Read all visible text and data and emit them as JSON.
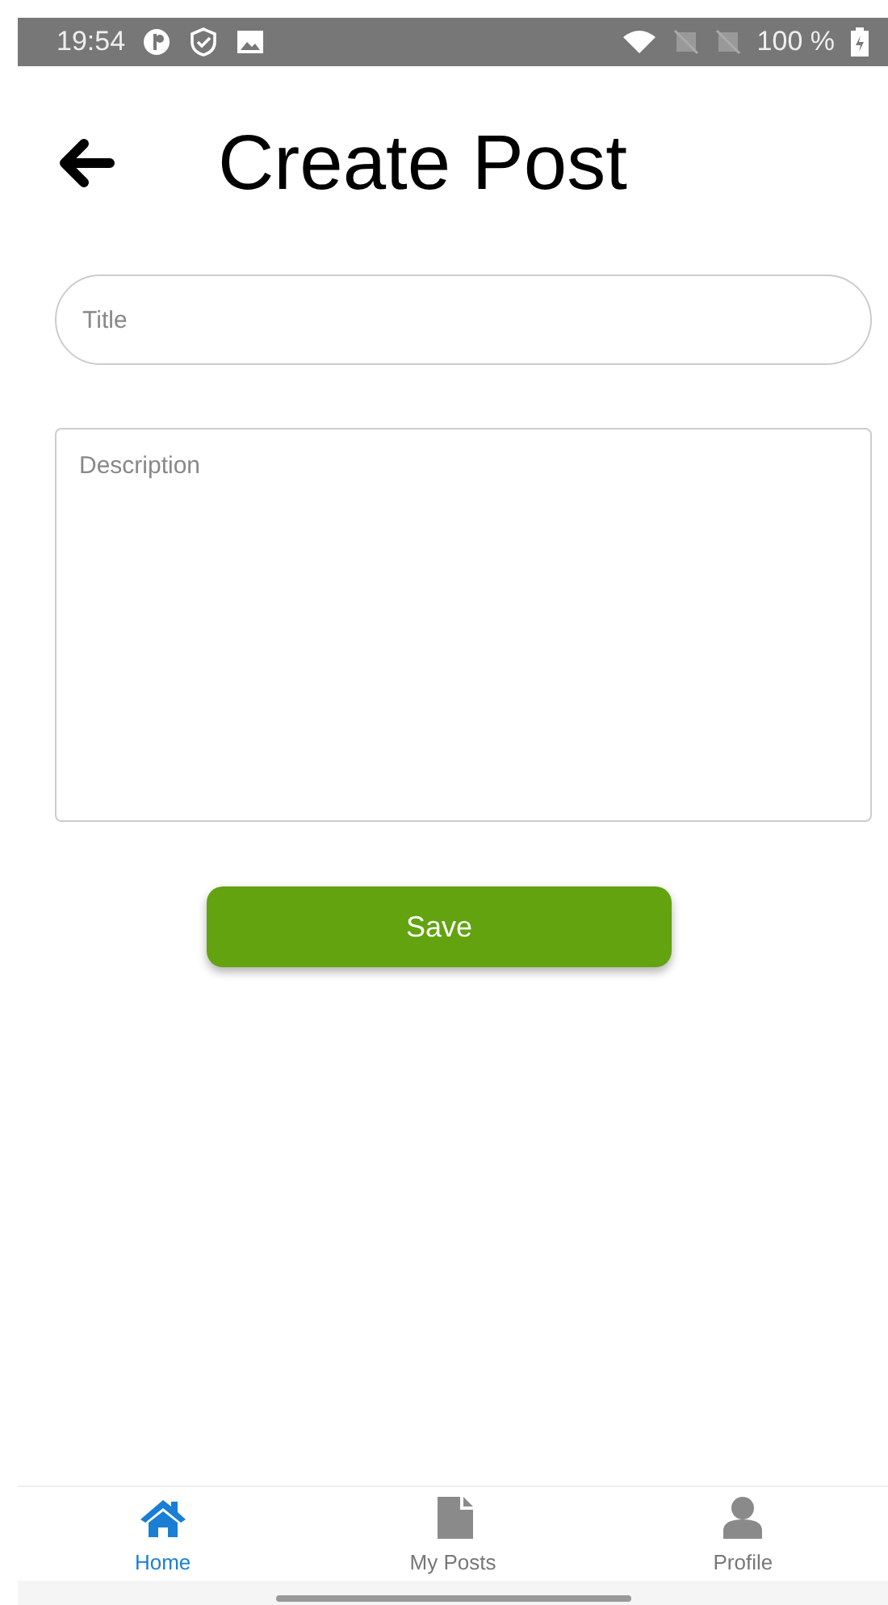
{
  "status_bar": {
    "time": "19:54",
    "battery": "100 %"
  },
  "header": {
    "title": "Create Post"
  },
  "form": {
    "title_field": {
      "placeholder": "Title"
    },
    "description_field": {
      "placeholder": "Description"
    },
    "save_button": "Save"
  },
  "bottom_nav": [
    {
      "label": "Home",
      "kind": "home",
      "selected": true
    },
    {
      "label": "My Posts",
      "kind": "document",
      "selected": false
    },
    {
      "label": "Profile",
      "kind": "person",
      "selected": false
    }
  ]
}
